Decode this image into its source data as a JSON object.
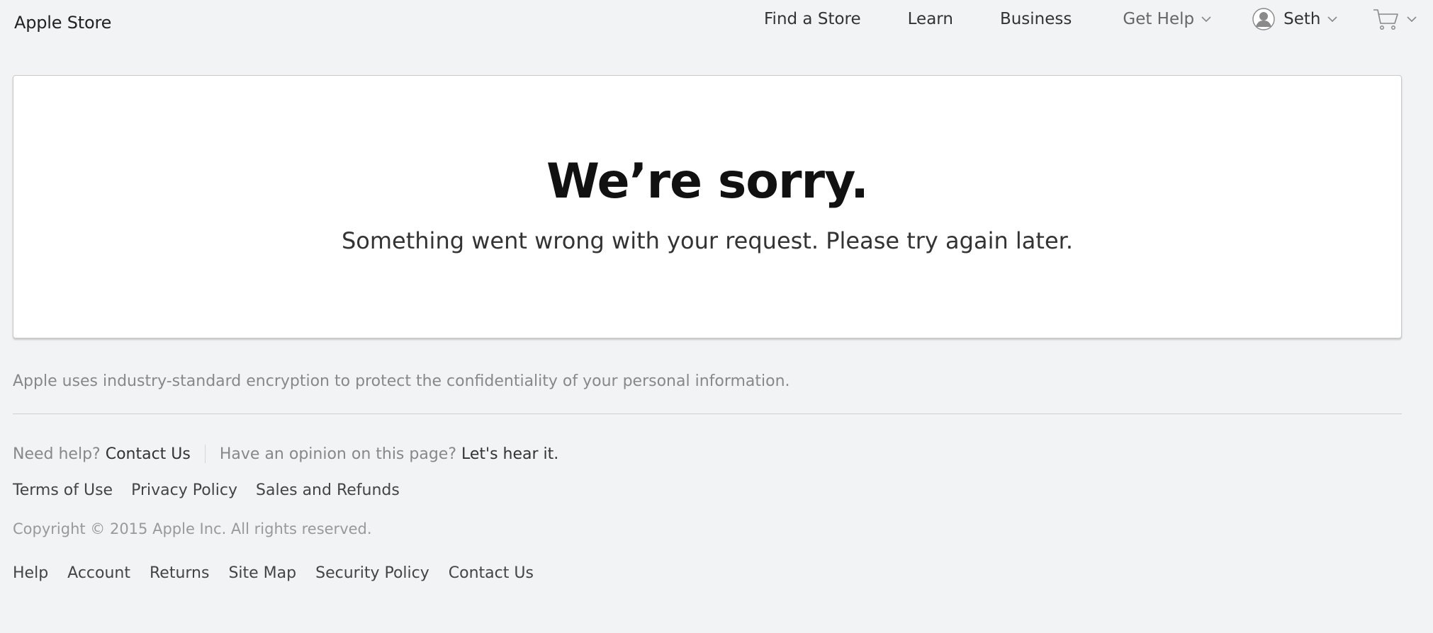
{
  "header": {
    "brand": "Apple Store",
    "nav": {
      "find_store": "Find a Store",
      "learn": "Learn",
      "business": "Business",
      "get_help": "Get Help",
      "user_name": "Seth"
    },
    "icons": {
      "user": "user-avatar-icon",
      "cart": "shopping-cart-icon",
      "chevron": "chevron-down-icon"
    }
  },
  "error": {
    "title": "We’re sorry.",
    "message": "Something went wrong with your request. Please try again later."
  },
  "security_note": "Apple uses industry-standard encryption to protect the confidentiality of your personal information.",
  "help": {
    "need_help": "Need help?",
    "contact_us": "Contact Us",
    "opinion": "Have an opinion on this page?",
    "feedback": "Let's hear it."
  },
  "legal_links": {
    "terms": "Terms of Use",
    "privacy": "Privacy Policy",
    "sales": "Sales and Refunds"
  },
  "copyright": "Copyright © 2015 Apple Inc. All rights reserved.",
  "footer_nav": {
    "help": "Help",
    "account": "Account",
    "returns": "Returns",
    "site_map": "Site Map",
    "security": "Security Policy",
    "contact": "Contact Us"
  },
  "colors": {
    "background": "#f2f3f5",
    "card": "#ffffff",
    "muted_text": "#888888",
    "dark_text": "#333333"
  }
}
